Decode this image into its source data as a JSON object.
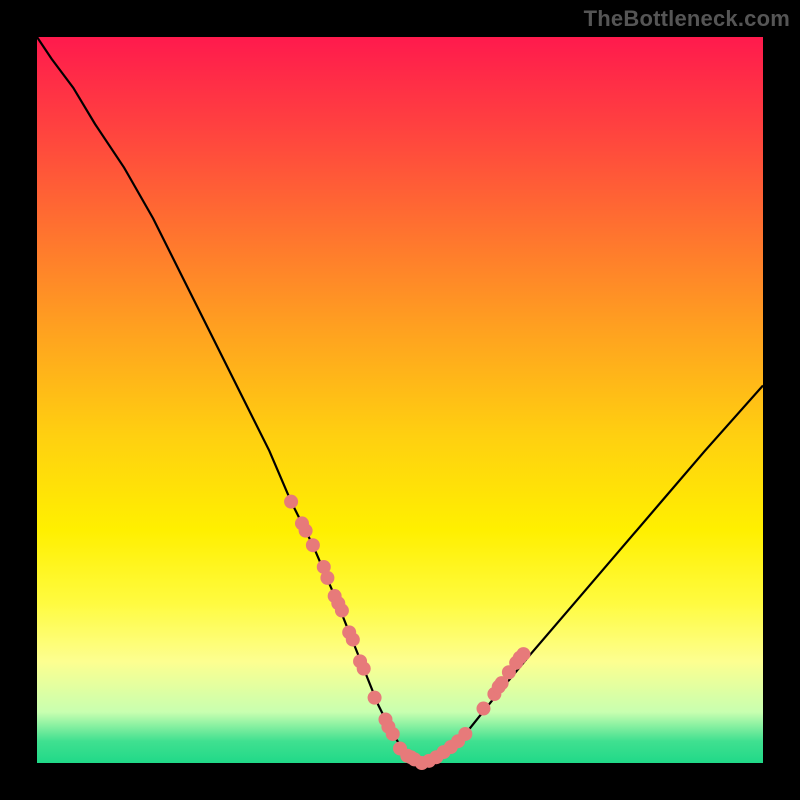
{
  "watermark": "TheBottleneck.com",
  "colors": {
    "frame": "#000000",
    "curve_stroke": "#000000",
    "marker_fill": "#e77a7a",
    "marker_stroke": "#c85a5a"
  },
  "chart_data": {
    "type": "line",
    "title": "",
    "xlabel": "",
    "ylabel": "",
    "xlim": [
      0,
      100
    ],
    "ylim": [
      0,
      100
    ],
    "series": [
      {
        "name": "bottleneck-curve",
        "x": [
          0,
          2,
          5,
          8,
          12,
          16,
          20,
          24,
          28,
          32,
          35,
          38,
          41,
          43,
          45,
          47,
          49,
          51,
          53,
          56,
          59,
          63,
          68,
          74,
          80,
          86,
          92,
          100
        ],
        "y": [
          100,
          97,
          93,
          88,
          82,
          75,
          67,
          59,
          51,
          43,
          36,
          30,
          23,
          18,
          13,
          8,
          4,
          1,
          0,
          1,
          4,
          9,
          15,
          22,
          29,
          36,
          43,
          52
        ]
      }
    ],
    "markers": [
      {
        "x": 35.0,
        "y": 36.0
      },
      {
        "x": 36.5,
        "y": 33.0
      },
      {
        "x": 37.0,
        "y": 32.0
      },
      {
        "x": 38.0,
        "y": 30.0
      },
      {
        "x": 39.5,
        "y": 27.0
      },
      {
        "x": 40.0,
        "y": 25.5
      },
      {
        "x": 41.0,
        "y": 23.0
      },
      {
        "x": 41.5,
        "y": 22.0
      },
      {
        "x": 42.0,
        "y": 21.0
      },
      {
        "x": 43.0,
        "y": 18.0
      },
      {
        "x": 43.5,
        "y": 17.0
      },
      {
        "x": 44.5,
        "y": 14.0
      },
      {
        "x": 45.0,
        "y": 13.0
      },
      {
        "x": 46.5,
        "y": 9.0
      },
      {
        "x": 48.0,
        "y": 6.0
      },
      {
        "x": 48.4,
        "y": 5.0
      },
      {
        "x": 49.0,
        "y": 4.0
      },
      {
        "x": 50.0,
        "y": 2.0
      },
      {
        "x": 51.0,
        "y": 1.0
      },
      {
        "x": 51.5,
        "y": 0.8
      },
      {
        "x": 52.0,
        "y": 0.5
      },
      {
        "x": 53.0,
        "y": 0.0
      },
      {
        "x": 54.0,
        "y": 0.3
      },
      {
        "x": 55.0,
        "y": 0.8
      },
      {
        "x": 56.0,
        "y": 1.5
      },
      {
        "x": 57.0,
        "y": 2.2
      },
      {
        "x": 58.0,
        "y": 3.0
      },
      {
        "x": 59.0,
        "y": 4.0
      },
      {
        "x": 61.5,
        "y": 7.5
      },
      {
        "x": 63.0,
        "y": 9.5
      },
      {
        "x": 63.6,
        "y": 10.5
      },
      {
        "x": 64.0,
        "y": 11.0
      },
      {
        "x": 65.0,
        "y": 12.5
      },
      {
        "x": 66.0,
        "y": 13.8
      },
      {
        "x": 66.5,
        "y": 14.5
      },
      {
        "x": 67.0,
        "y": 15.0
      }
    ]
  }
}
